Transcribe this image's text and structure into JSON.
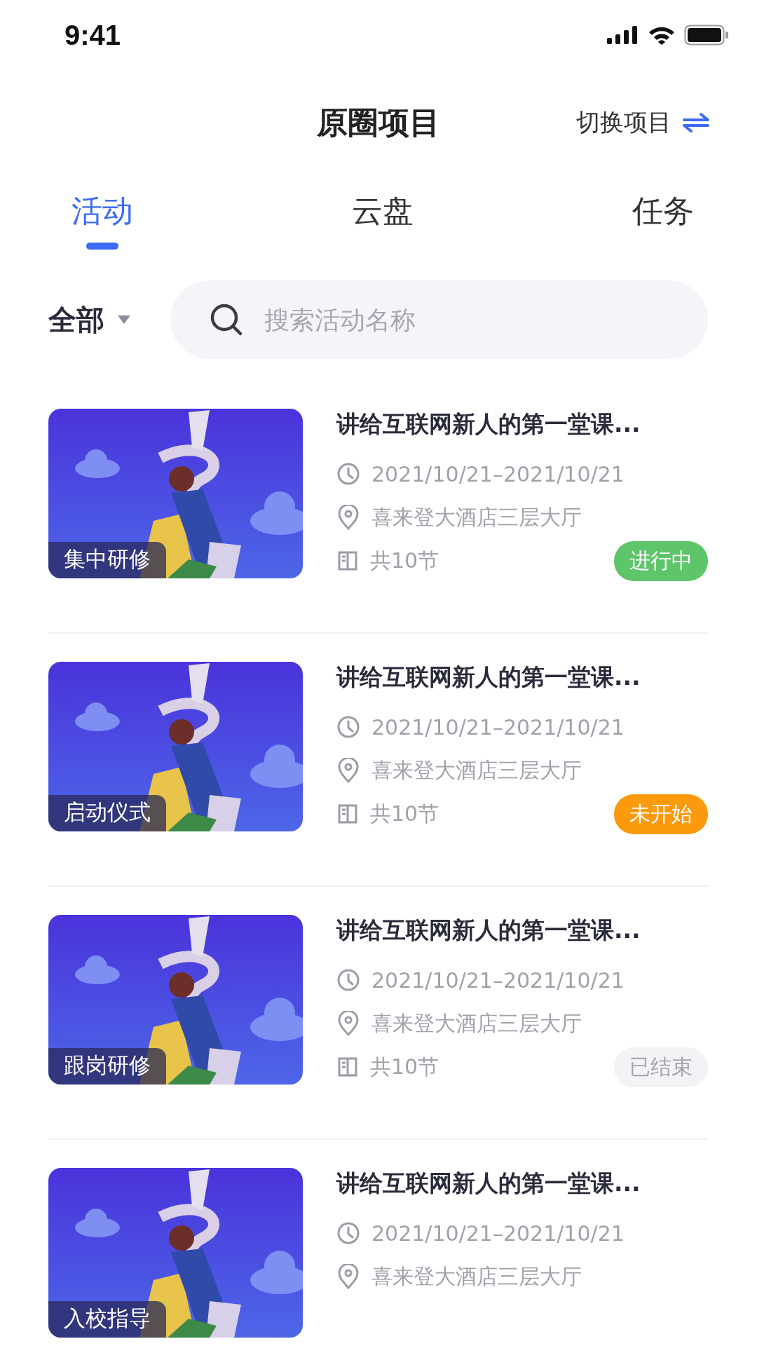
{
  "status_bar": {
    "time": "9:41"
  },
  "header": {
    "title": "原圈项目",
    "switch_label": "切换项目"
  },
  "tabs": [
    {
      "label": "活动",
      "selected": true
    },
    {
      "label": "云盘",
      "selected": false
    },
    {
      "label": "任务",
      "selected": false
    }
  ],
  "filter": {
    "label": "全部"
  },
  "search": {
    "placeholder": "搜索活动名称"
  },
  "activities": [
    {
      "category": "集中研修",
      "title": "讲给互联网新人的第一堂课...",
      "date": "2021/10/21–2021/10/21",
      "location": "喜来登大酒店三层大厅",
      "sessions": "共10节",
      "status": {
        "label": "进行中",
        "kind": "ongoing"
      }
    },
    {
      "category": "启动仪式",
      "title": "讲给互联网新人的第一堂课...",
      "date": "2021/10/21–2021/10/21",
      "location": "喜来登大酒店三层大厅",
      "sessions": "共10节",
      "status": {
        "label": "未开始",
        "kind": "pending"
      }
    },
    {
      "category": "跟岗研修",
      "title": "讲给互联网新人的第一堂课...",
      "date": "2021/10/21–2021/10/21",
      "location": "喜来登大酒店三层大厅",
      "sessions": "共10节",
      "status": {
        "label": "已结束",
        "kind": "ended"
      }
    },
    {
      "category": "入校指导",
      "title": "讲给互联网新人的第一堂课...",
      "date": "2021/10/21–2021/10/21",
      "location": "喜来登大酒店三层大厅"
    }
  ]
}
